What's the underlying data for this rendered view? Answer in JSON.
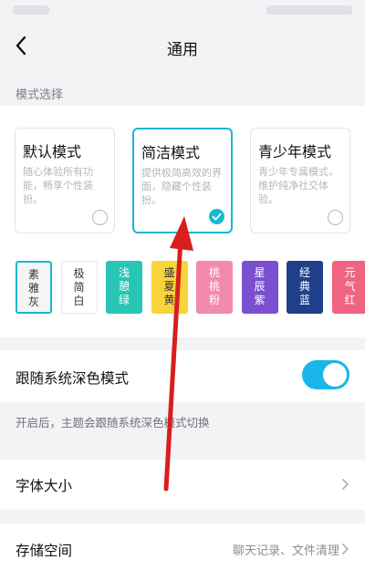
{
  "header": {
    "title": "通用"
  },
  "mode_section": {
    "label": "模式选择"
  },
  "modes": [
    {
      "title": "默认模式",
      "desc": "随心体验所有功能，畅享个性装扮。",
      "selected": false
    },
    {
      "title": "简洁模式",
      "desc": "提供极简高效的界面，隐藏个性装扮。",
      "selected": true
    },
    {
      "title": "青少年模式",
      "desc": "青少年专属模式，维护纯净社交体验。",
      "selected": false
    }
  ],
  "accent_color": "#18b8d1",
  "themes": [
    {
      "label": "素雅灰",
      "bg": "#f5f5f5",
      "color": "#333333",
      "selected": true
    },
    {
      "label": "极简白",
      "bg": "#ffffff",
      "color": "#333333",
      "selected": false
    },
    {
      "label": "浅憩绿",
      "bg": "#27c6b4",
      "color": "#ffffff",
      "selected": false
    },
    {
      "label": "盛夏黄",
      "bg": "#f7d43a",
      "color": "#333333",
      "selected": false
    },
    {
      "label": "桃桃粉",
      "bg": "#f28ab0",
      "color": "#ffffff",
      "selected": false
    },
    {
      "label": "星辰紫",
      "bg": "#7a4fd0",
      "color": "#ffffff",
      "selected": false
    },
    {
      "label": "经典蓝",
      "bg": "#1f3f8a",
      "color": "#ffffff",
      "selected": false
    },
    {
      "label": "元气红",
      "bg": "#f06482",
      "color": "#ffffff",
      "selected": false
    }
  ],
  "dark_follow": {
    "label": "跟随系统深色模式",
    "enabled": true,
    "hint": "开启后，主题会跟随系统深色模式切换"
  },
  "font_size": {
    "label": "字体大小"
  },
  "storage": {
    "label": "存储空间",
    "value": "聊天记录、文件清理"
  }
}
